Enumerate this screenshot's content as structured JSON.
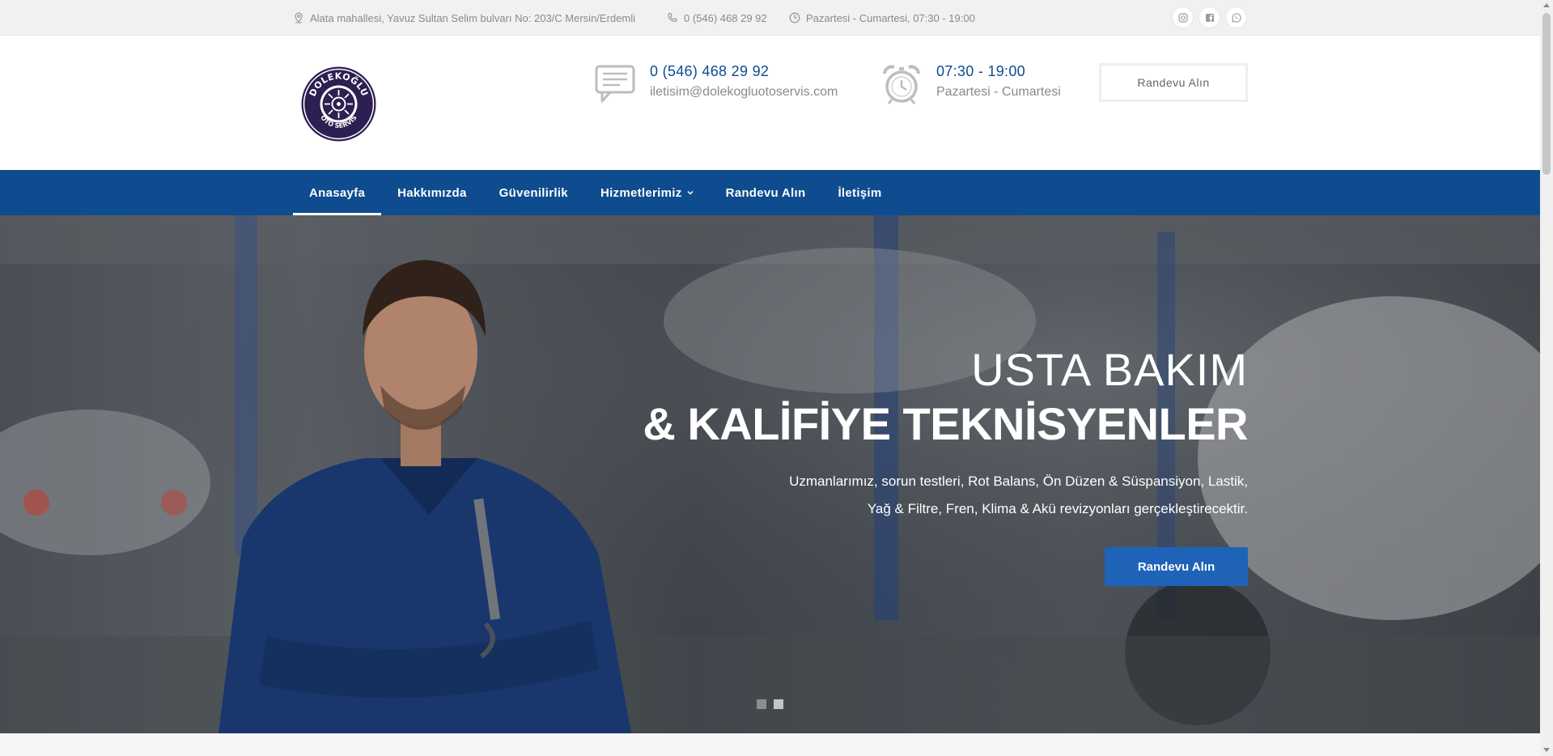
{
  "topbar": {
    "address": "Alata mahallesi, Yavuz Sultan Selim bulvarı No: 203/C Mersin/Erdemli",
    "phone": "0 (546) 468 29 92",
    "hours": "Pazartesi - Cumartesi, 07:30 - 19:00",
    "social": [
      "instagram-icon",
      "facebook-icon",
      "whatsapp-icon"
    ]
  },
  "header": {
    "logo_text_top": "DOLEKOĞLU",
    "logo_text_bottom": "OTO SERVİS",
    "phone_title": "0 (546) 468 29 92",
    "phone_sub": "iletisim@dolekogluotoservis.com",
    "hours_title": "07:30 - 19:00",
    "hours_sub": "Pazartesi - Cumartesi",
    "appointment_button": "Randevu Alın"
  },
  "nav": {
    "items": [
      {
        "label": "Anasayfa",
        "active": true
      },
      {
        "label": "Hakkımızda"
      },
      {
        "label": "Güvenilirlik"
      },
      {
        "label": "Hizmetlerimiz",
        "dropdown": true
      },
      {
        "label": "Randevu Alın"
      },
      {
        "label": "İletişim"
      }
    ]
  },
  "hero": {
    "title_line1": "USTA BAKIM",
    "title_line2": "& KALİFİYE TEKNİSYENLER",
    "text_line1": "Uzmanlarımız, sorun testleri, Rot Balans, Ön Düzen & Süspansiyon, Lastik,",
    "text_line2": "Yağ & Filtre, Fren, Klima & Akü revizyonları gerçekleştirecektir.",
    "button": "Randevu Alın",
    "slides": 2,
    "active_slide": 2
  },
  "colors": {
    "brand_blue": "#0e4c8f",
    "button_blue": "#1e63b7",
    "logo_purple": "#2e1f52"
  }
}
